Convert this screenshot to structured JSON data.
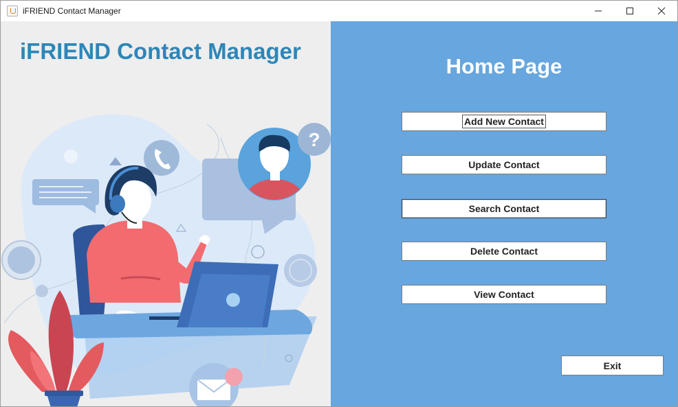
{
  "window": {
    "title": "iFRIEND Contact Manager",
    "controls": [
      "minimize",
      "maximize",
      "close"
    ]
  },
  "left_panel": {
    "brand_title": "iFRIEND Contact Manager",
    "illustration_icons": [
      "phone-icon",
      "question-icon",
      "chat-bubble-icon",
      "mail-icon",
      "headset-icon",
      "laptop-icon",
      "plant-icon"
    ]
  },
  "right_panel": {
    "page_title": "Home Page",
    "buttons": {
      "add": "Add New Contact",
      "update": "Update Contact",
      "search": "Search Contact",
      "delete": "Delete Contact",
      "view": "View Contact"
    },
    "exit": "Exit"
  },
  "colors": {
    "brand_blue": "#2e86b8",
    "panel_blue": "#67a6de",
    "left_bg": "#eeeeee"
  }
}
